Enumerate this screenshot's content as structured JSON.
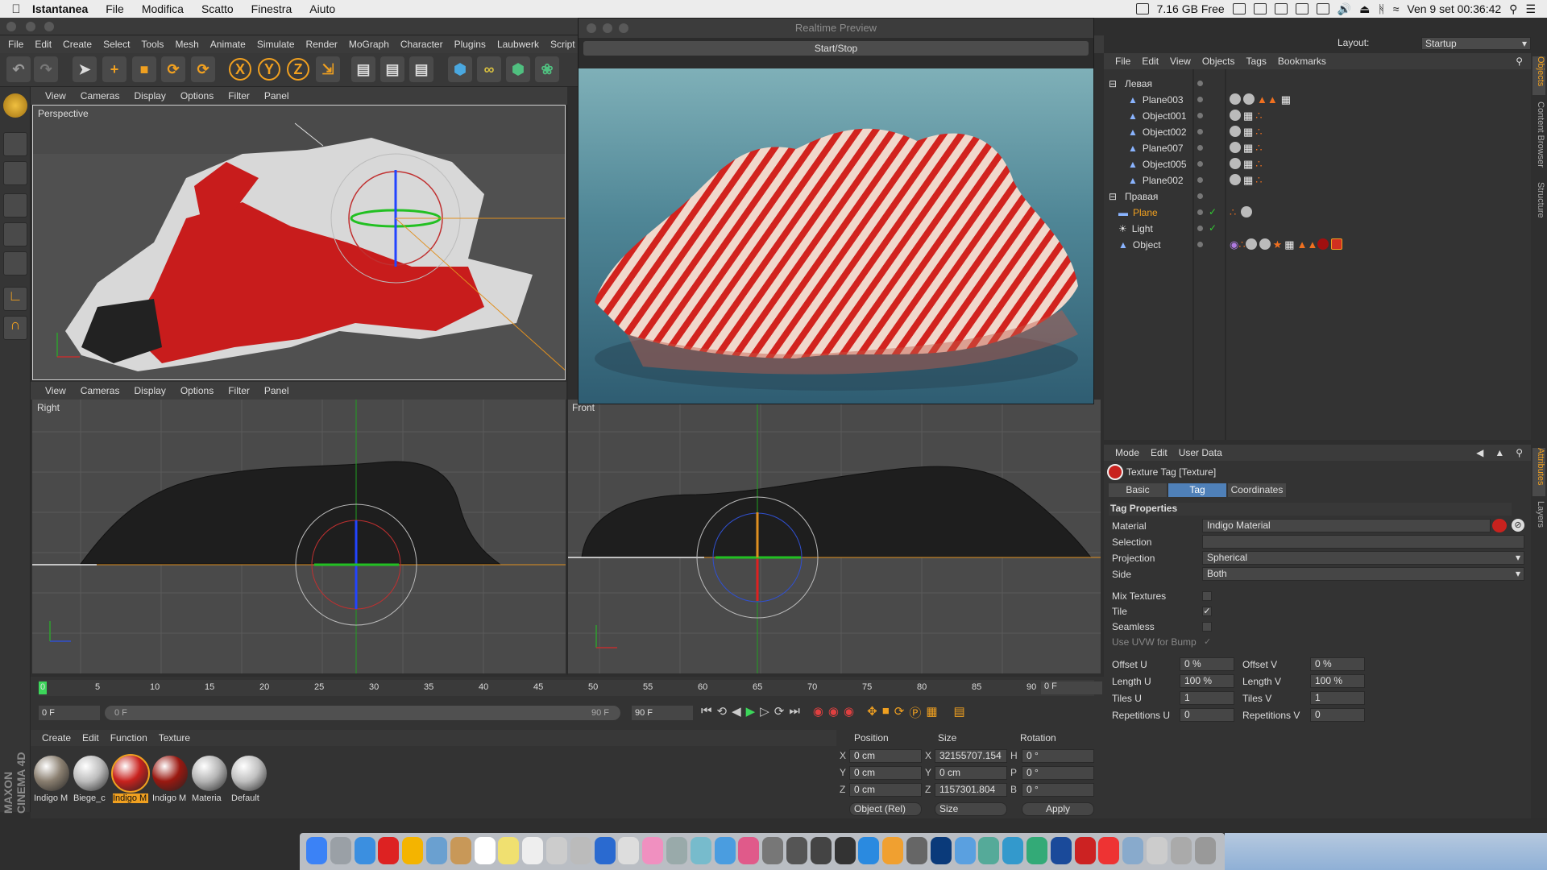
{
  "mac_menubar": {
    "app_name": "Istantanea",
    "items": [
      "File",
      "Modifica",
      "Scatto",
      "Finestra",
      "Aiuto"
    ],
    "disk_free": "7.16 GB Free",
    "clock": "Ven 9 set  00:36:42"
  },
  "app_menu": [
    "File",
    "Edit",
    "Create",
    "Select",
    "Tools",
    "Mesh",
    "Animate",
    "Simulate",
    "Render",
    "MoGraph",
    "Character",
    "Plugins",
    "Laubwerk",
    "Script"
  ],
  "layout": {
    "label": "Layout:",
    "value": "Startup"
  },
  "viewport_menu": [
    "View",
    "Cameras",
    "Display",
    "Options",
    "Filter",
    "Panel"
  ],
  "viewports": {
    "perspective": "Perspective",
    "right": "Right",
    "front": "Front"
  },
  "preview": {
    "title": "Realtime Preview",
    "start_stop": "Start/Stop"
  },
  "object_manager": {
    "menu": [
      "File",
      "Edit",
      "View",
      "Objects",
      "Tags",
      "Bookmarks"
    ],
    "objects": [
      {
        "name": "Левая",
        "level": 0,
        "selected": false
      },
      {
        "name": "Plane003",
        "level": 1,
        "selected": false
      },
      {
        "name": "Object001",
        "level": 1,
        "selected": false
      },
      {
        "name": "Object002",
        "level": 1,
        "selected": false
      },
      {
        "name": "Plane007",
        "level": 1,
        "selected": false
      },
      {
        "name": "Object005",
        "level": 1,
        "selected": false
      },
      {
        "name": "Plane002",
        "level": 1,
        "selected": false
      },
      {
        "name": "Правая",
        "level": 0,
        "selected": false
      },
      {
        "name": "Plane",
        "level": 1,
        "selected": true
      },
      {
        "name": "Light",
        "level": 1,
        "selected": false
      },
      {
        "name": "Object",
        "level": 1,
        "selected": false
      }
    ]
  },
  "side_tabs": {
    "right_top": [
      "Objects",
      "Content Browser",
      "Structure"
    ],
    "right_bottom": [
      "Attributes",
      "Layers"
    ]
  },
  "attributes": {
    "menu": [
      "Mode",
      "Edit",
      "User Data"
    ],
    "title": "Texture Tag [Texture]",
    "tabs": [
      "Basic",
      "Tag",
      "Coordinates"
    ],
    "active_tab": "Tag",
    "section": "Tag Properties",
    "material_label": "Material",
    "material_value": "Indigo Material",
    "selection_label": "Selection",
    "selection_value": "",
    "projection_label": "Projection",
    "projection_value": "Spherical",
    "side_label": "Side",
    "side_value": "Both",
    "mix_label": "Mix Textures",
    "tile_label": "Tile",
    "seamless_label": "Seamless",
    "uvw_label": "Use UVW for Bump",
    "offset_u_label": "Offset U",
    "offset_u": "0 %",
    "offset_v_label": "Offset V",
    "offset_v": "0 %",
    "length_u_label": "Length U",
    "length_u": "100 %",
    "length_v_label": "Length V",
    "length_v": "100 %",
    "tiles_u_label": "Tiles U",
    "tiles_u": "1",
    "tiles_v_label": "Tiles V",
    "tiles_v": "1",
    "rep_u_label": "Repetitions U",
    "rep_u": "0",
    "rep_v_label": "Repetitions V",
    "rep_v": "0"
  },
  "timeline": {
    "ticks": [
      "0",
      "5",
      "10",
      "15",
      "20",
      "25",
      "30",
      "35",
      "40",
      "45",
      "50",
      "55",
      "60",
      "65",
      "70",
      "75",
      "80",
      "85",
      "90"
    ],
    "current_frame": "0 F",
    "start_field": "0 F",
    "range_start": "0 F",
    "range_end": "90 F",
    "end_field": "90 F"
  },
  "materials": {
    "menu": [
      "Create",
      "Edit",
      "Function",
      "Texture"
    ],
    "items": [
      {
        "name": "Indigo M",
        "color": "#8a7f70"
      },
      {
        "name": "Biege_c",
        "color": "#bdbdbd"
      },
      {
        "name": "Indigo M",
        "color": "#c8221e"
      },
      {
        "name": "Indigo M",
        "color": "#9a1810"
      },
      {
        "name": "Materia",
        "color": "#b5b5b5"
      },
      {
        "name": "Default",
        "color": "#c0c0c0"
      }
    ]
  },
  "coordinates": {
    "headers": [
      "Position",
      "Size",
      "Rotation"
    ],
    "pos_x": "0 cm",
    "pos_y": "0 cm",
    "pos_z": "0 cm",
    "size_x": "32155707.154",
    "size_y": "0 cm",
    "size_z": "1157301.804",
    "rot_h": "0 °",
    "rot_p": "0 °",
    "rot_b": "0 °",
    "mode": "Object (Rel)",
    "size_mode": "Size",
    "apply": "Apply"
  },
  "brand": "MAXON CINEMA 4D",
  "colors": {
    "accent": "#f0a020",
    "selected_tab": "#4f80b8",
    "viewport_bg": "#4a4a4a"
  }
}
